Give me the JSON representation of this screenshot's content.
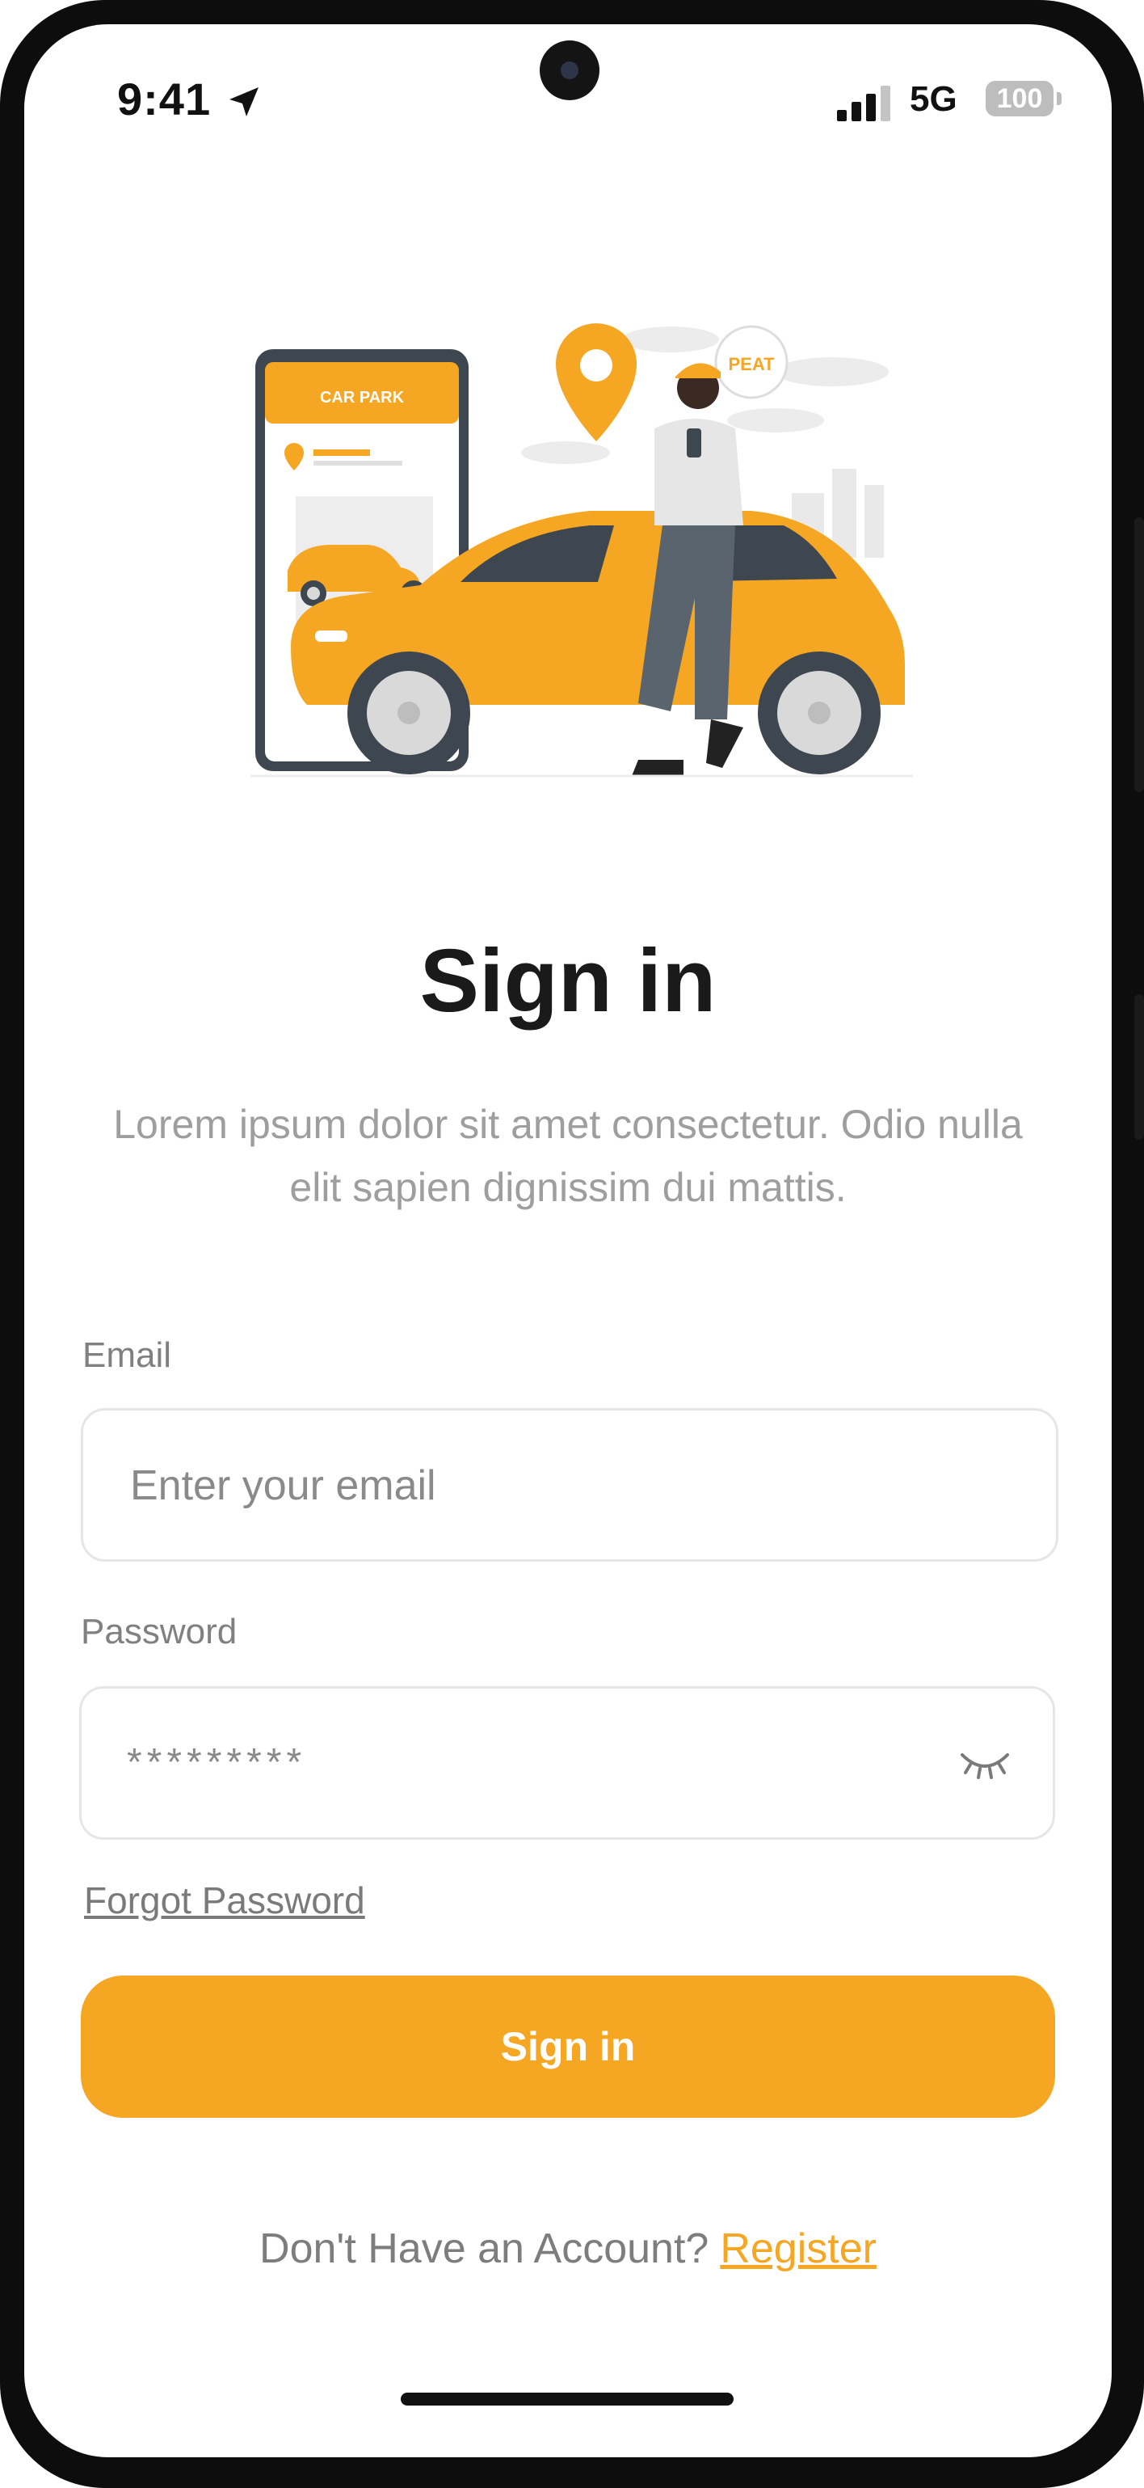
{
  "status_bar": {
    "time": "9:41",
    "network": "5G",
    "battery": "100"
  },
  "illustration": {
    "phone_app_title": "CAR PARK",
    "speech_bubble": "PEAT"
  },
  "heading": "Sign in",
  "subtitle": "Lorem ipsum dolor sit amet consectetur. Odio nulla elit sapien dignissim dui mattis.",
  "form": {
    "email_label": "Email",
    "email_placeholder": "Enter your email",
    "password_label": "Password",
    "password_value": "*********",
    "forgot_password": "Forgot Password",
    "submit_label": "Sign in"
  },
  "footer": {
    "prompt": "Don't Have an Account?",
    "register_link": "Register"
  },
  "colors": {
    "accent": "#F5A623",
    "text_dark": "#1a1a1a",
    "text_muted": "#9e9e9e",
    "field_border": "#e6e6e6"
  },
  "icons": [
    "location-arrow-icon",
    "signal-icon",
    "battery-icon",
    "eye-closed-icon"
  ]
}
